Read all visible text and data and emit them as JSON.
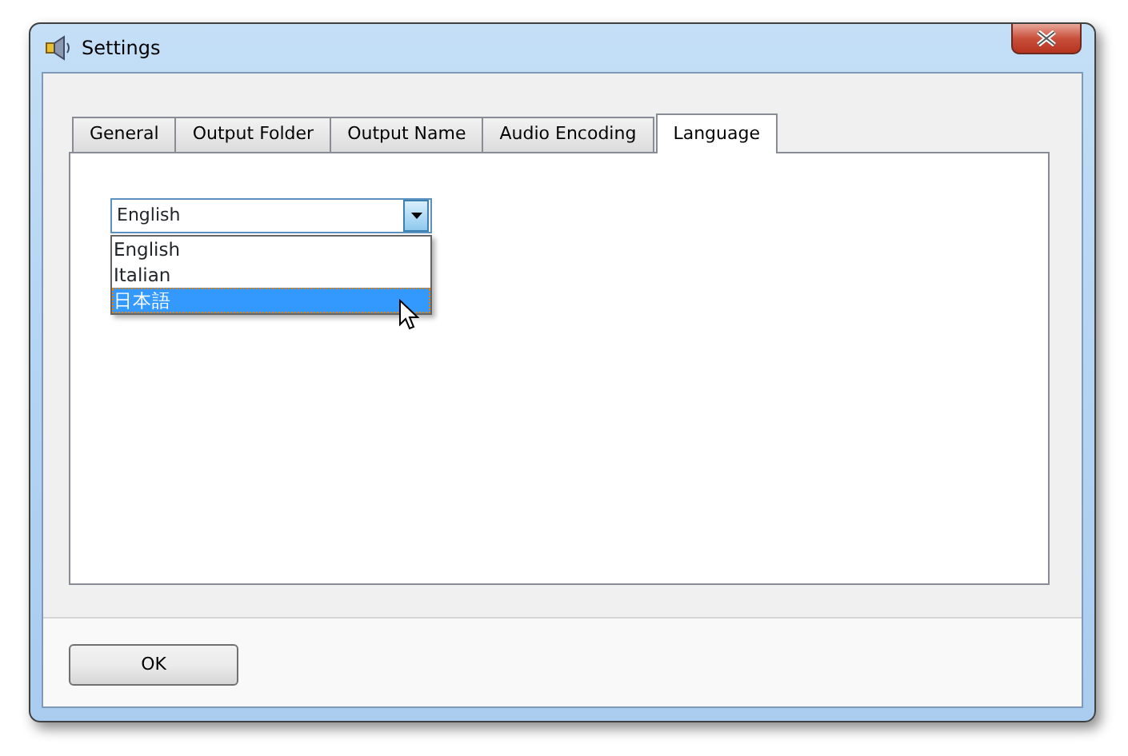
{
  "window": {
    "title": "Settings"
  },
  "tabs": [
    {
      "label": "General",
      "selected": false
    },
    {
      "label": "Output Folder",
      "selected": false
    },
    {
      "label": "Output Name",
      "selected": false
    },
    {
      "label": "Audio Encoding",
      "selected": false
    },
    {
      "label": "Language",
      "selected": true
    }
  ],
  "language_combo": {
    "value": "English",
    "expanded": true
  },
  "language_options": [
    {
      "label": "English",
      "selected": false
    },
    {
      "label": "Italian",
      "selected": false
    },
    {
      "label": "日本語",
      "selected": true
    }
  ],
  "buttons": [
    {
      "label": "OK"
    }
  ]
}
